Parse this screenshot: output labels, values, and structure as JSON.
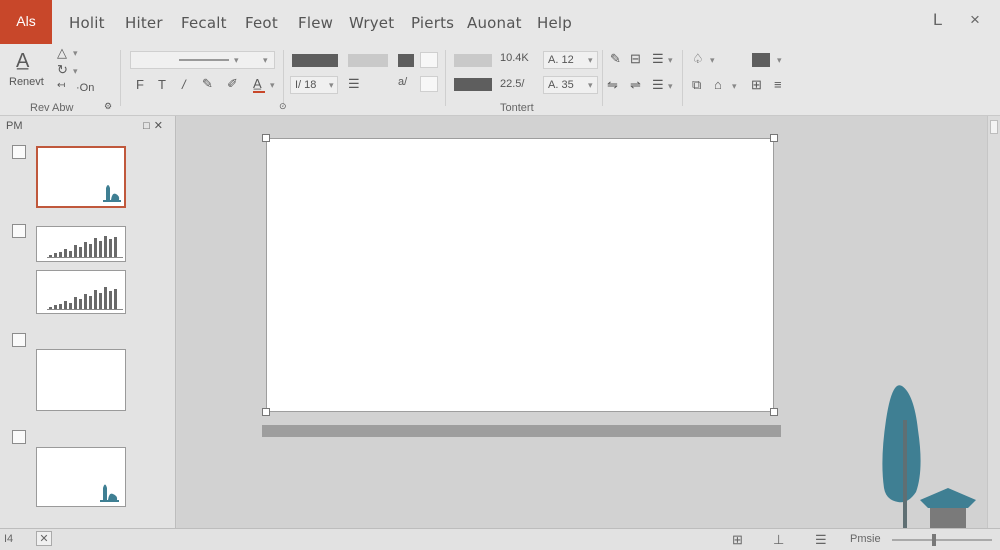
{
  "app": {
    "tab_label": "Als"
  },
  "menu": {
    "items": [
      "Holit",
      "Hiter",
      "Fecalt",
      "Feot",
      "Flew",
      "Wryet",
      "Pierts",
      "Auonat",
      "Help"
    ]
  },
  "window_controls": {
    "minimize": "L",
    "close": "×"
  },
  "ribbon": {
    "renew_label": "Renevt",
    "renew_icon": "text-cursor-icon",
    "font_buttons": [
      "F",
      "T",
      "/"
    ],
    "size_dropdown": "I/ 18",
    "value_a": "10.4K",
    "value_b": "22.5/",
    "value_c": "A. 12",
    "value_d": "A. 35",
    "side_label": "·On",
    "group_labels": {
      "first": "Rev Abw",
      "second": "Tontert"
    }
  },
  "slide_panel": {
    "header": "PM",
    "actions": [
      "□",
      "✕"
    ]
  },
  "statusbar": {
    "left_label": "I4",
    "close_label": "✕",
    "zoom_label": "Pmsie"
  },
  "colors": {
    "accent": "#c8472a",
    "tree": "#3f7f93"
  }
}
